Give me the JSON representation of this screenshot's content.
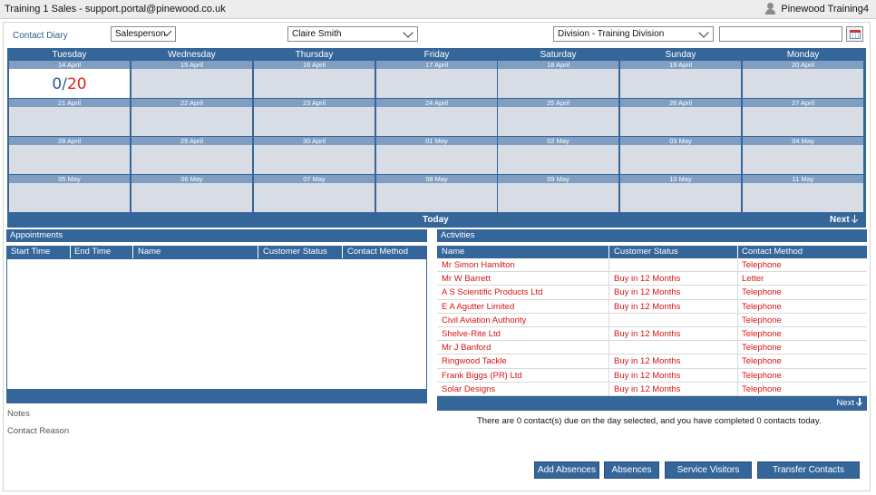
{
  "titlebar": {
    "title": "Training 1 Sales - support.portal@pinewood.co.uk",
    "user": "Pinewood Training4"
  },
  "toolbar": {
    "diary_label": "Contact Diary",
    "salesperson_select": "Salesperson",
    "person_select": "Claire Smith",
    "division_select": "Division - Training Division",
    "date_value": ""
  },
  "calendar": {
    "days": [
      "Tuesday",
      "Wednesday",
      "Thursday",
      "Friday",
      "Saturday",
      "Sunday",
      "Monday"
    ],
    "weeks": [
      [
        "14 April",
        "15 April",
        "16 April",
        "17 April",
        "18 April",
        "19 April",
        "20 April"
      ],
      [
        "21 April",
        "22 April",
        "23 April",
        "24 April",
        "25 April",
        "26 April",
        "27 April"
      ],
      [
        "28 April",
        "29 April",
        "30 April",
        "01 May",
        "02 May",
        "03 May",
        "04 May"
      ],
      [
        "05 May",
        "06 May",
        "07 May",
        "08 May",
        "09 May",
        "10 May",
        "11 May"
      ]
    ],
    "selected_done": "0",
    "selected_slash": "/",
    "selected_due": "20",
    "today_label": "Today",
    "next_label": "Next"
  },
  "appointments": {
    "title": "Appointments",
    "columns": [
      "Start Time",
      "End Time",
      "Name",
      "Customer Status",
      "Contact Method"
    ]
  },
  "notes_label": "Notes",
  "contact_reason_label": "Contact Reason",
  "activities": {
    "title": "Activities",
    "columns": [
      "Name",
      "Customer Status",
      "Contact Method"
    ],
    "rows": [
      [
        "Mr Simon Hamilton",
        "",
        "Telephone"
      ],
      [
        "Mr W Barrett",
        "Buy in 12 Months",
        "Letter"
      ],
      [
        "A S Scientific Products Ltd",
        "Buy in 12 Months",
        "Telephone"
      ],
      [
        "E A Agutter Limited",
        "Buy in 12 Months",
        "Telephone"
      ],
      [
        "Civil Aviation Authority",
        "",
        "Telephone"
      ],
      [
        "Shelve-Rite Ltd",
        "Buy in 12 Months",
        "Telephone"
      ],
      [
        "Mr J Banford",
        "",
        "Telephone"
      ],
      [
        "Ringwood Tackle",
        "Buy in 12 Months",
        "Telephone"
      ],
      [
        "Frank Biggs (PR) Ltd",
        "Buy in 12 Months",
        "Telephone"
      ],
      [
        "Solar Designs",
        "Buy in 12 Months",
        "Telephone"
      ]
    ],
    "next_label": "Next"
  },
  "summary": "There are 0 contact(s) due on the day selected, and you have completed 0 contacts today.",
  "buttons": {
    "add_absences": "Add Absences",
    "absences": "Absences",
    "service_visitors": "Service Visitors",
    "transfer_contacts": "Transfer Contacts"
  },
  "colors": {
    "header_blue": "#35669a",
    "date_strip": "#7f9ec2",
    "cell_bg": "#d8dde5",
    "activity_text": "#d81414"
  }
}
